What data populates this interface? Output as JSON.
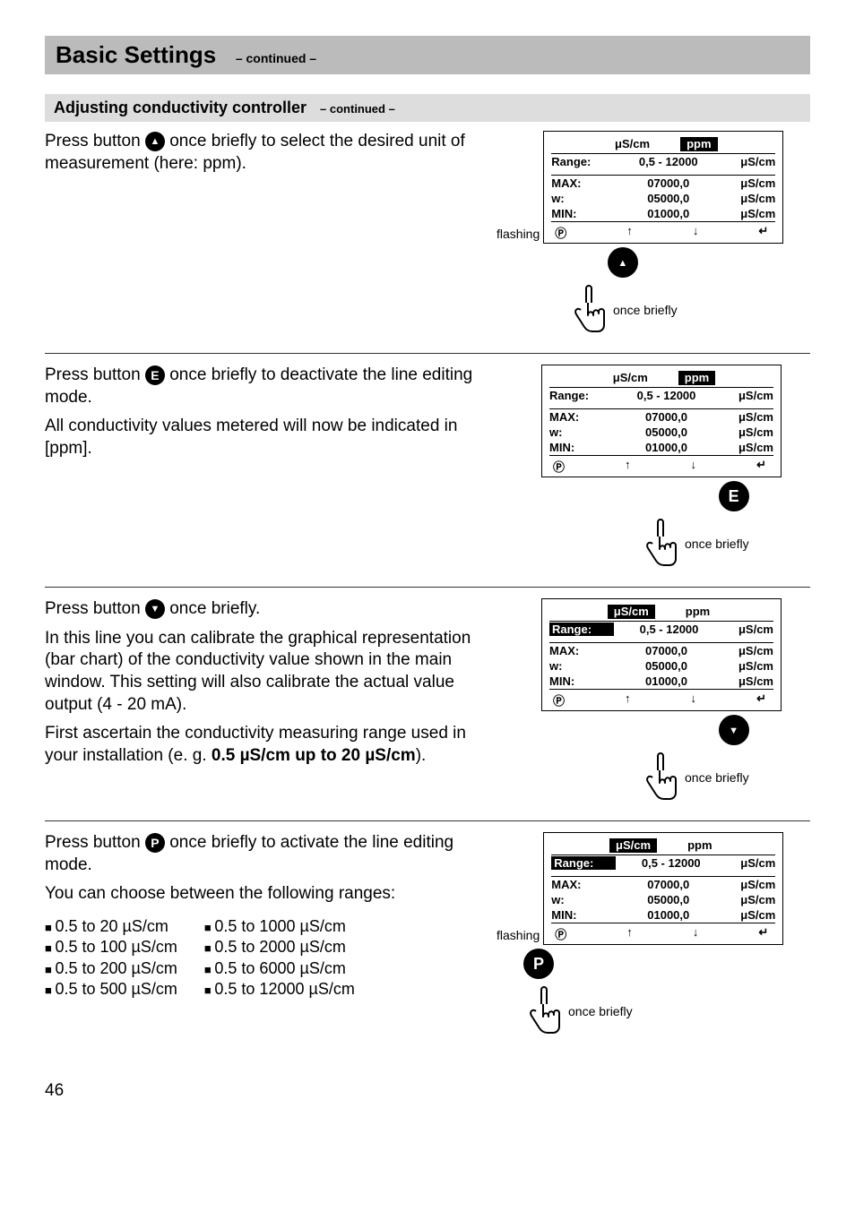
{
  "page_number": "46",
  "section_title": "Basic Settings",
  "section_continued": "– continued –",
  "sub_title": "Adjusting conductivity controller",
  "sub_continued": "– continued –",
  "flashing_label": "flashing",
  "once_briefly": "once briefly",
  "steps": [
    {
      "text_plain_before": "Press button ",
      "button_letter": "",
      "button_kind": "up",
      "text_plain_after": " once briefly to select the desired unit of measurement (here: ppm).",
      "paragraphs": [],
      "lcd": {
        "tab_left": "µS/cm",
        "tab_left_style": "plain",
        "tab_right": "ppm",
        "tab_right_style": "inv",
        "range_label": "Range:",
        "range_label_inv": false,
        "range_val": "0,5 - 12000",
        "range_unit": "µS/cm",
        "rows": [
          {
            "lbl": "MAX:",
            "val": "07000,0",
            "unit": "µS/cm"
          },
          {
            "lbl": "w:",
            "val": "05000,0",
            "unit": "µS/cm"
          },
          {
            "lbl": "MIN:",
            "val": "01000,0",
            "unit": "µS/cm"
          }
        ]
      },
      "flashing": true,
      "press_button_kind": "up",
      "press_pos": "center"
    },
    {
      "text_plain_before": "Press button ",
      "button_letter": "E",
      "button_kind": "letter",
      "text_plain_after": " once briefly to deactivate the line editing mode.",
      "paragraphs": [
        "All conductivity values metered will now be indicated in [ppm]."
      ],
      "lcd": {
        "tab_left": "µS/cm",
        "tab_left_style": "plain",
        "tab_right": "ppm",
        "tab_right_style": "inv",
        "range_label": "Range:",
        "range_label_inv": false,
        "range_val": "0,5 - 12000",
        "range_unit": "µS/cm",
        "rows": [
          {
            "lbl": "MAX:",
            "val": "07000,0",
            "unit": "µS/cm"
          },
          {
            "lbl": "w:",
            "val": "05000,0",
            "unit": "µS/cm"
          },
          {
            "lbl": "MIN:",
            "val": "01000,0",
            "unit": "µS/cm"
          }
        ]
      },
      "flashing": false,
      "press_button_kind": "E",
      "press_pos": "right"
    },
    {
      "text_plain_before": "Press button ",
      "button_letter": "",
      "button_kind": "down",
      "text_plain_after": " once briefly.",
      "paragraphs": [
        "In this line you can calibrate the graphical representation (bar chart) of the conductivity value shown in the main window. This setting will also calibrate the actual value output (4 - 20 mA).",
        "First ascertain the conductivity measuring range used in your installation (e. g. 0.5 µS/cm up to 20 µS/cm)."
      ],
      "bold_tail": "0.5 µS/cm up to 20 µS/cm",
      "lcd": {
        "tab_left": "µS/cm",
        "tab_left_style": "inv",
        "tab_right": "ppm",
        "tab_right_style": "plain",
        "range_label": "Range:",
        "range_label_inv": true,
        "range_val": "0,5 - 12000",
        "range_unit": "µS/cm",
        "rows": [
          {
            "lbl": "MAX:",
            "val": "07000,0",
            "unit": "µS/cm"
          },
          {
            "lbl": "w:",
            "val": "05000,0",
            "unit": "µS/cm"
          },
          {
            "lbl": "MIN:",
            "val": "01000,0",
            "unit": "µS/cm"
          }
        ]
      },
      "flashing": false,
      "press_button_kind": "down",
      "press_pos": "right"
    },
    {
      "text_plain_before": "Press button ",
      "button_letter": "P",
      "button_kind": "letter",
      "text_plain_after": " once briefly to activate the line editing mode.",
      "paragraphs": [
        "You can choose between the following ranges:"
      ],
      "ranges_left": [
        "0.5 to   20 µS/cm",
        "0.5 to 100 µS/cm",
        "0.5 to 200 µS/cm",
        "0.5 to 500 µS/cm"
      ],
      "ranges_right": [
        "0.5 to   1000 µS/cm",
        "0.5 to   2000 µS/cm",
        "0.5 to   6000 µS/cm",
        "0.5 to 12000 µS/cm"
      ],
      "lcd": {
        "tab_left": "µS/cm",
        "tab_left_style": "inv",
        "tab_right": "ppm",
        "tab_right_style": "plain",
        "range_label": "Range:",
        "range_label_inv": true,
        "range_val": "0,5 - 12000",
        "range_unit": "µS/cm",
        "rows": [
          {
            "lbl": "MAX:",
            "val": "07000,0",
            "unit": "µS/cm"
          },
          {
            "lbl": "w:",
            "val": "05000,0",
            "unit": "µS/cm"
          },
          {
            "lbl": "MIN:",
            "val": "01000,0",
            "unit": "µS/cm"
          }
        ]
      },
      "flashing": true,
      "press_button_kind": "P",
      "press_pos": "pleft"
    }
  ]
}
